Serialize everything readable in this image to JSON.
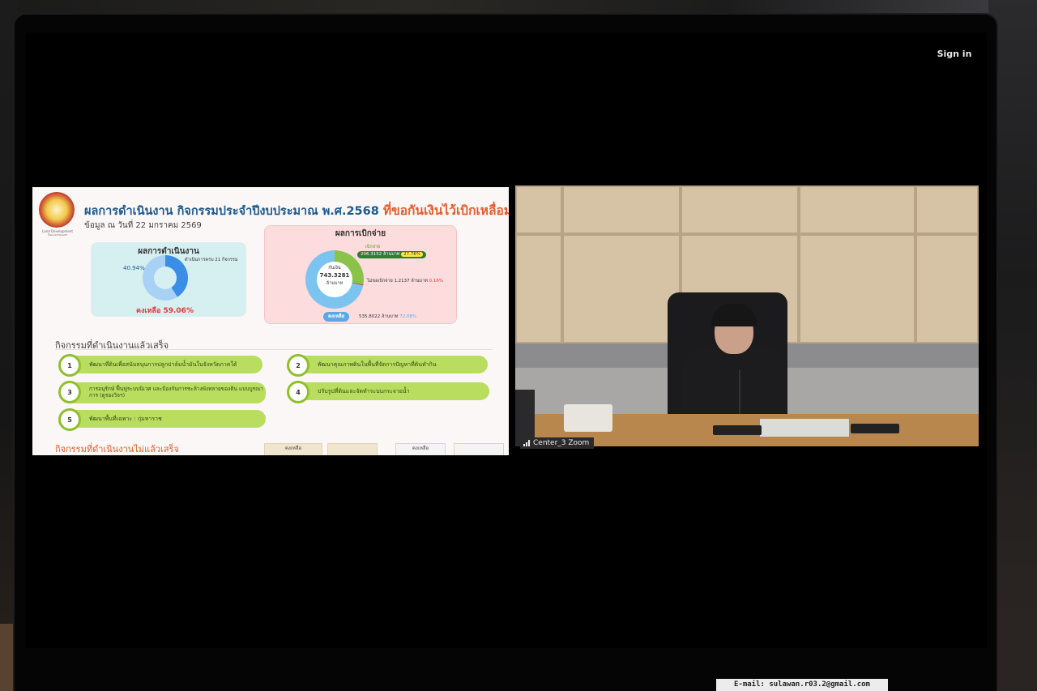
{
  "app": {
    "sign_in_label": "Sign in"
  },
  "slide": {
    "logo_caption": "Land Development Department",
    "title_main": "ผลการดำเนินงาน กิจกรรมประจำปีงบประมาณ พ.ศ.2568",
    "title_highlight": "ที่ขอกันเงินไว้เบิกเหลื่อมปี",
    "subtitle": "ข้อมูล ณ วันที่ 22 มกราคม 2569",
    "performance": {
      "title": "ผลการดำเนินงาน",
      "done_pct": "40.94%",
      "done_fraction": 0.4094,
      "note": "ดำเนินการครบ 21 กิจกรรม",
      "remaining": "คงเหลือ 59.06%"
    },
    "disbursement": {
      "title": "ผลการเบิกจ่าย",
      "center_label": "กันเงิน",
      "center_value": "743.3281",
      "center_unit": "ล้านบาท",
      "spent_label": "เบิกจ่าย",
      "spent_value": "206.3152 ล้านบาท",
      "spent_pct": "27.76%",
      "pending_value": "ไม่ขอเบิกจ่าย 1.2137  ล้านบาท",
      "pending_pct": "0.16%",
      "remain_label": "คงเหลือ",
      "remain_value": "535.8022  ล้านบาท",
      "remain_pct": "72.08%"
    },
    "completed_header": "กิจกรรมที่ดำเนินงานแล้วเสร็จ",
    "completed_items": [
      {
        "num": "1",
        "text": "พัฒนาที่ดินเพื่อสนับสนุนการปลูกปาล์มน้ำมันในจังหวัดภาคใต้"
      },
      {
        "num": "2",
        "text": "พัฒนาคุณภาพดินในพื้นที่จัดการปัญหาที่ดินทำกิน"
      },
      {
        "num": "3",
        "text": "การอนุรักษ์ ฟื้นฟูระบบนิเวศ และป้องกันการชะล้างพังทลายของดิน แบบบูรณาการ (ดูรองวิจฯ)"
      },
      {
        "num": "4",
        "text": "ปรับรูปที่ดินและจัดทำระบบกระจายน้ำ"
      },
      {
        "num": "5",
        "text": "พัฒนาพื้นที่เฉพาะ : กุ่มหาราช"
      }
    ],
    "not_completed_header": "กิจกรรมที่ดำเนินงานไม่แล้วเสร็จ",
    "bottom_tabs": [
      "คงเหลือ",
      "",
      "คงเหลือ",
      ""
    ]
  },
  "video": {
    "participant_name": "Center_3 Zoom"
  },
  "footer_label": "E-mail: sulawan.r03.2@gmail.com",
  "colors": {
    "title_blue": "#1e5a8e",
    "title_orange": "#e55b2a",
    "activity_green": "#b9dd5f",
    "remaining_red": "#e53935"
  }
}
